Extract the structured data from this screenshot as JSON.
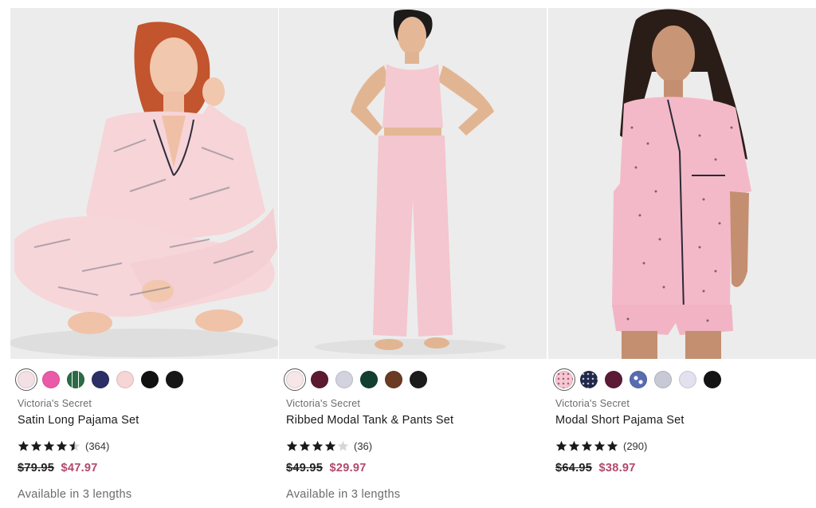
{
  "products": [
    {
      "image_alt": "Satin Long Pajama Set",
      "swatches": [
        {
          "color": "#f3e0e4",
          "selected": true
        },
        {
          "color": "#ea5aa9"
        },
        {
          "color": "#2c6b46",
          "pattern": "stripe"
        },
        {
          "color": "#2b2f66"
        },
        {
          "color": "#f6d5d6"
        },
        {
          "color": "#111111"
        },
        {
          "color": "#161616"
        }
      ],
      "brand": "Victoria's Secret",
      "name": "Satin Long Pajama Set",
      "rating": 4.5,
      "reviews": "(364)",
      "original_price": "$79.95",
      "sale_price": "$47.97",
      "availability": "Available in 3 lengths"
    },
    {
      "image_alt": "Ribbed Modal Tank & Pants Set",
      "swatches": [
        {
          "color": "#f7e6e8",
          "selected": true
        },
        {
          "color": "#5c1a30"
        },
        {
          "color": "#d2d3df"
        },
        {
          "color": "#133f30"
        },
        {
          "color": "#6a3a22"
        },
        {
          "color": "#1c1c1c"
        }
      ],
      "brand": "Victoria's Secret",
      "name": "Ribbed Modal Tank & Pants Set",
      "rating": 4,
      "reviews": "(36)",
      "original_price": "$49.95",
      "sale_price": "$29.97",
      "availability": "Available in 3 lengths"
    },
    {
      "image_alt": "Modal Short Pajama Set",
      "swatches": [
        {
          "color": "#f4c8d3",
          "selected": true,
          "pattern": "dots"
        },
        {
          "color": "#22284a",
          "pattern": "dots"
        },
        {
          "color": "#5c1a36"
        },
        {
          "color": "#5a6cb0",
          "pattern": "floral"
        },
        {
          "color": "#c7c9d4"
        },
        {
          "color": "#e3e1ee"
        },
        {
          "color": "#141414"
        }
      ],
      "brand": "Victoria's Secret",
      "name": "Modal Short Pajama Set",
      "rating": 5,
      "reviews": "(290)",
      "original_price": "$64.95",
      "sale_price": "$38.97"
    }
  ],
  "colors": {
    "sale": "#b3486b",
    "brand_text": "#6b6b6b",
    "photo_bg": "#ececec"
  }
}
